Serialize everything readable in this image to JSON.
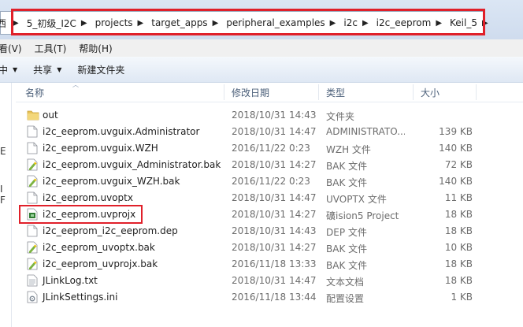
{
  "address": {
    "crumbs": [
      "5_初级_I2C",
      "projects",
      "target_apps",
      "peripheral_examples",
      "i2c",
      "i2c_eeprom",
      "Keil_5"
    ],
    "leading_fragment": "西"
  },
  "menu": {
    "items": [
      "看(V)",
      "工具(T)",
      "帮助(H)"
    ]
  },
  "toolbar": {
    "organize": "中",
    "share": "共享",
    "new_folder": "新建文件夹"
  },
  "leftnav": {
    "fragments": [
      "E",
      "I F"
    ]
  },
  "columns": {
    "name": "名称",
    "date": "修改日期",
    "type": "类型",
    "size": "大小"
  },
  "files": [
    {
      "name": "out",
      "date": "2018/10/31 14:43",
      "type": "文件夹",
      "size": "",
      "icon": "folder-icon"
    },
    {
      "name": "i2c_eeprom.uvguix.Administrator",
      "date": "2018/10/31 14:47",
      "type": "ADMINISTRATO...",
      "size": "139 KB",
      "icon": "file-icon"
    },
    {
      "name": "i2c_eeprom.uvguix.WZH",
      "date": "2016/11/22 0:23",
      "type": "WZH 文件",
      "size": "140 KB",
      "icon": "file-icon"
    },
    {
      "name": "i2c_eeprom.uvguix_Administrator.bak",
      "date": "2018/10/31 14:27",
      "type": "BAK 文件",
      "size": "72 KB",
      "icon": "bak-icon"
    },
    {
      "name": "i2c_eeprom.uvguix_WZH.bak",
      "date": "2016/11/22 0:23",
      "type": "BAK 文件",
      "size": "140 KB",
      "icon": "bak-icon"
    },
    {
      "name": "i2c_eeprom.uvoptx",
      "date": "2018/10/31 14:47",
      "type": "UVOPTX 文件",
      "size": "11 KB",
      "icon": "file-icon"
    },
    {
      "name": "i2c_eeprom.uvprojx",
      "date": "2018/10/31 14:27",
      "type": "礦ision5 Project",
      "size": "18 KB",
      "icon": "uvision-project-icon",
      "highlighted": true
    },
    {
      "name": "i2c_eeprom_i2c_eeprom.dep",
      "date": "2018/10/31 14:43",
      "type": "DEP 文件",
      "size": "18 KB",
      "icon": "file-icon"
    },
    {
      "name": "i2c_eeprom_uvoptx.bak",
      "date": "2018/10/31 14:27",
      "type": "BAK 文件",
      "size": "10 KB",
      "icon": "bak-icon"
    },
    {
      "name": "i2c_eeprom_uvprojx.bak",
      "date": "2016/11/18 13:33",
      "type": "BAK 文件",
      "size": "18 KB",
      "icon": "bak-icon"
    },
    {
      "name": "JLinkLog.txt",
      "date": "2018/10/31 14:47",
      "type": "文本文档",
      "size": "18 KB",
      "icon": "text-file-icon"
    },
    {
      "name": "JLinkSettings.ini",
      "date": "2016/11/18 13:44",
      "type": "配置设置",
      "size": "1 KB",
      "icon": "settings-file-icon"
    }
  ],
  "colors": {
    "highlight": "#e0202a",
    "folder": "#e8c35a",
    "header_text": "#4c607a"
  }
}
